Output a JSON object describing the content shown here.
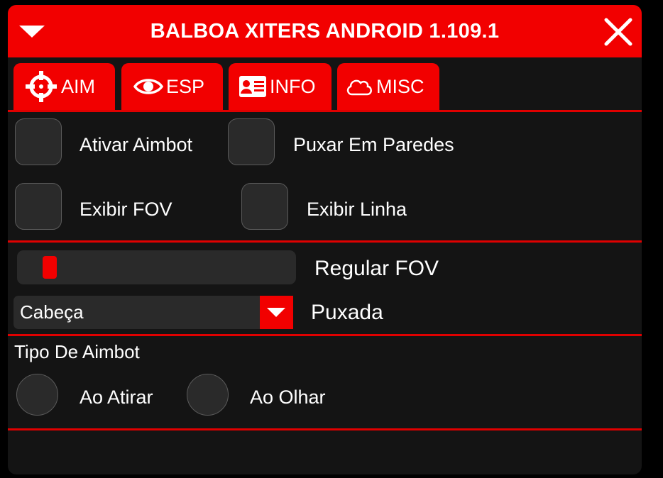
{
  "window": {
    "title": "BALBOA XITERS ANDROID 1.109.1",
    "collapse_icon": "triangle-down-icon",
    "close_icon": "close-icon"
  },
  "colors": {
    "accent": "#f20000",
    "panel_bg": "#141414",
    "control_bg": "#2a2a2a",
    "text": "#ffffff"
  },
  "tabs": [
    {
      "label": "AIM",
      "icon": "crosshair-icon",
      "active": true
    },
    {
      "label": "ESP",
      "icon": "eye-icon",
      "active": false
    },
    {
      "label": "INFO",
      "icon": "id-card-icon",
      "active": false
    },
    {
      "label": "MISC",
      "icon": "cloud-icon",
      "active": false
    }
  ],
  "toggles": [
    {
      "label": "Ativar Aimbot",
      "checked": false
    },
    {
      "label": "Puxar Em Paredes",
      "checked": false
    },
    {
      "label": "Exibir FOV",
      "checked": false
    },
    {
      "label": "Exibir Linha",
      "checked": false
    }
  ],
  "fov_slider": {
    "label": "Regular FOV",
    "value_fraction": 0.07
  },
  "target_dropdown": {
    "label": "Puxada",
    "selected": "Cabeça"
  },
  "aimbot_type": {
    "heading": "Tipo De Aimbot",
    "options": [
      {
        "label": "Ao Atirar",
        "selected": false
      },
      {
        "label": "Ao Olhar",
        "selected": false
      }
    ]
  }
}
